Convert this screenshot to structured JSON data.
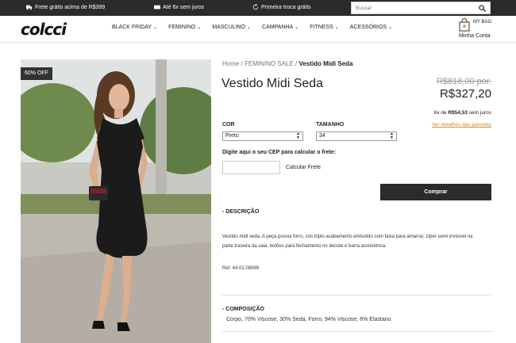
{
  "topbar": {
    "promo_shipping": "Frete grátis acima de R$399",
    "promo_installments": "Até 6x sem juros",
    "promo_exchange": "Primeira troca grátis",
    "search_placeholder": "Buscar"
  },
  "header": {
    "logo": "colcci",
    "nav": [
      {
        "label": "BLACK FRIDAY"
      },
      {
        "label": "FEMININO"
      },
      {
        "label": "MASCULINO"
      },
      {
        "label": "CAMPANHA"
      },
      {
        "label": "FITNESS"
      },
      {
        "label": "ACESSÓRIOS"
      }
    ],
    "bag_label": "MY BAG",
    "account_label": "Minha Conta"
  },
  "product": {
    "discount_badge": "60% OFF",
    "breadcrumb": {
      "home": "Home",
      "sep1": " / ",
      "category": "FEMININO SALE",
      "sep2": " / ",
      "current": "Vestido Midi Seda"
    },
    "title": "Vestido Midi Seda",
    "old_price": "R$818,00 por.",
    "new_price": "R$327,20",
    "installments_prefix": "6x de ",
    "installments_value": "R$54,53",
    "installments_suffix": " sem juros",
    "installments_link": "Ver detalhes das parcelas",
    "color_label": "COR",
    "color_value": "Preto",
    "size_label": "TAMANHO",
    "size_value": "34",
    "cep_label": "Digite aqui o seu CEP para calcular o frete:",
    "cep_placeholder": "",
    "cep_button": "Calcular Frete",
    "buy_button": "Comprar",
    "description_head": "- DESCRIÇÃO",
    "description_text": "Vestido midi seda. A peça possui forro, cós triplo acabamento embutido com faixa para amarrar, zíper semi invisível na parte traseira da saia, botões para fechamento no decote e barra assimétrica.",
    "ref": "Ref. 44.01.08089",
    "composition_head": "- COMPOSIÇÃO",
    "composition_text": "Corpo, 70% Viscose, 30% Seda, Forro, 94% Viscose, 6% Elastano"
  },
  "colors": {
    "topbar_bg": "#2b2b2b",
    "buy_bg": "#2b2b2b",
    "link_orange": "#d98a1e"
  }
}
